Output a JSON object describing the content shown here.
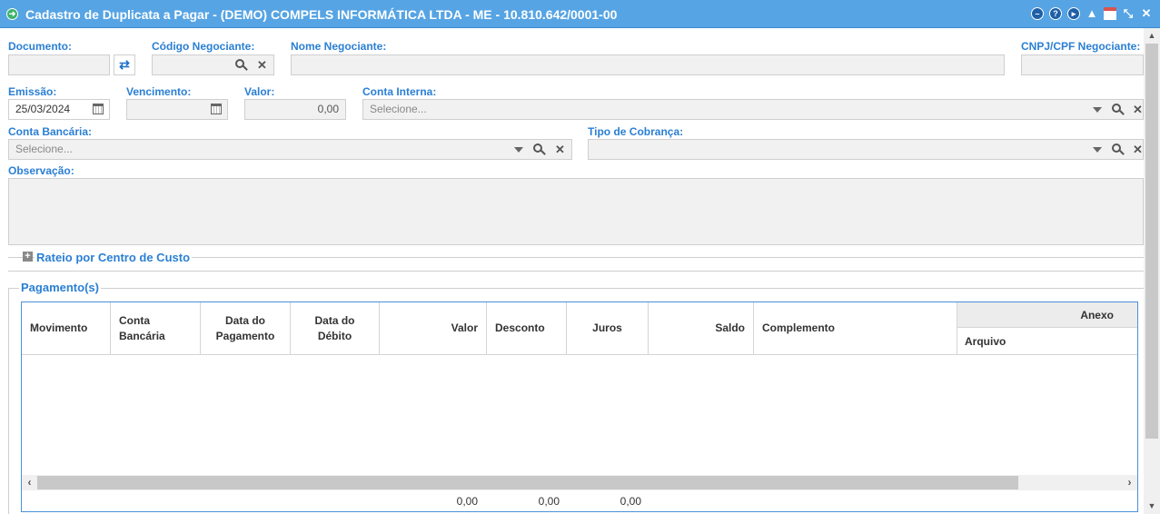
{
  "window": {
    "title": "Cadastro de Duplicata a Pagar - (DEMO) COMPELS INFORMÁTICA LTDA - ME - 10.810.642/0001-00",
    "app_icon": "arrow-circle-icon",
    "controls": [
      "minimize-icon",
      "help-icon",
      "play-icon",
      "notification-icon",
      "calendar-icon",
      "collapse-icon",
      "close-icon"
    ]
  },
  "form": {
    "documento_label": "Documento:",
    "documento_value": "",
    "codigo_label": "Código Negociante:",
    "codigo_value": "",
    "nome_label": "Nome Negociante:",
    "nome_value": "",
    "cnpj_label": "CNPJ/CPF Negociante:",
    "cnpj_value": "",
    "emissao_label": "Emissão:",
    "emissao_value": "25/03/2024",
    "vencimento_label": "Vencimento:",
    "vencimento_value": "",
    "valor_label": "Valor:",
    "valor_value": "0,00",
    "conta_interna_label": "Conta Interna:",
    "conta_interna_placeholder": "Selecione...",
    "conta_bancaria_label": "Conta Bancária:",
    "conta_bancaria_placeholder": "Selecione...",
    "tipo_cobranca_label": "Tipo de Cobrança:",
    "tipo_cobranca_value": "",
    "observacao_label": "Observação:",
    "observacao_value": ""
  },
  "rateio": {
    "title": "Rateio por Centro de Custo"
  },
  "pagamentos": {
    "title": "Pagamento(s)",
    "columns": {
      "movimento": "Movimento",
      "conta_bancaria": "Conta Bancária",
      "data_pagamento": "Data do Pagamento",
      "data_debito": "Data do Débito",
      "valor": "Valor",
      "desconto": "Desconto",
      "juros": "Juros",
      "saldo": "Saldo",
      "complemento": "Complemento",
      "anexo": "Anexo",
      "arquivo": "Arquivo"
    },
    "rows": [],
    "totals": {
      "valor": "0,00",
      "desconto": "0,00",
      "juros": "0,00"
    }
  }
}
